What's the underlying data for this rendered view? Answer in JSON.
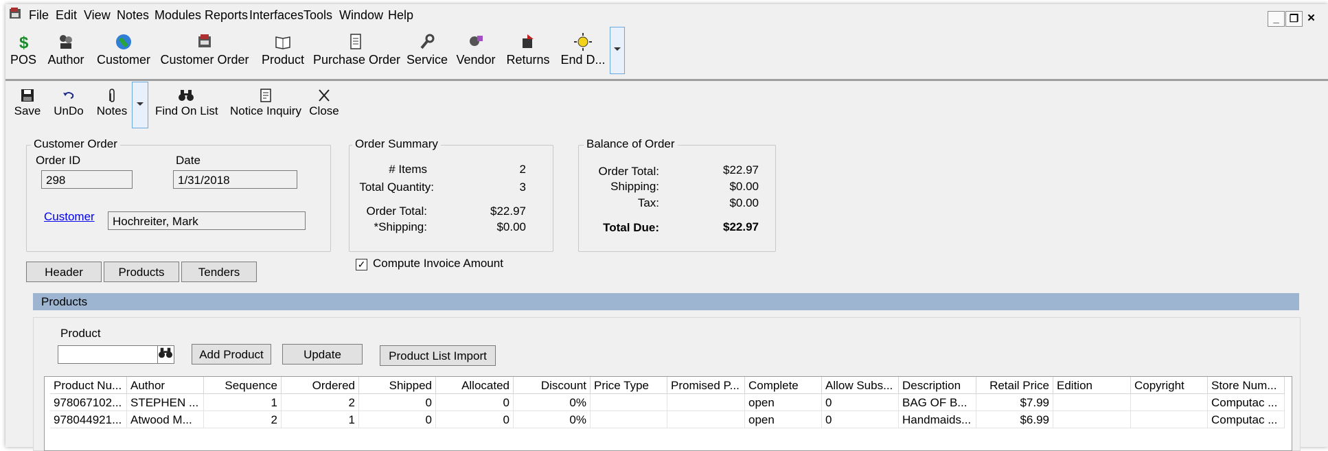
{
  "menu": [
    "File",
    "Edit",
    "View",
    "Notes",
    "Modules",
    "Reports",
    "Interfaces",
    "Tools",
    "Window",
    "Help"
  ],
  "window_controls": {
    "minimize": "_",
    "restore": "❐",
    "close": "✕"
  },
  "modules": [
    {
      "label": "POS",
      "icon": "dollar-icon"
    },
    {
      "label": "Author",
      "icon": "author-icon"
    },
    {
      "label": "Customer",
      "icon": "globe-icon"
    },
    {
      "label": "Customer Order",
      "icon": "register-icon"
    },
    {
      "label": "Product",
      "icon": "book-icon"
    },
    {
      "label": "Purchase Order",
      "icon": "document-icon"
    },
    {
      "label": "Service",
      "icon": "wrench-icon"
    },
    {
      "label": "Vendor",
      "icon": "vendor-icon"
    },
    {
      "label": "Returns",
      "icon": "returns-icon"
    },
    {
      "label": "End D...",
      "icon": "sun-icon"
    }
  ],
  "form_toolbar": {
    "save": "Save",
    "undo": "UnDo",
    "notes": "Notes",
    "find": "Find On List",
    "notice": "Notice Inquiry",
    "close": "Close"
  },
  "customer_order": {
    "title": "Customer Order",
    "order_id_label": "Order ID",
    "order_id": "298",
    "date_label": "Date",
    "date": "1/31/2018",
    "customer_label": "Customer",
    "customer": "Hochreiter, Mark"
  },
  "order_summary": {
    "title": "Order Summary",
    "items_label": "# Items",
    "items": "2",
    "qty_label": "Total Quantity:",
    "qty": "3",
    "total_label": "Order Total:",
    "total": "$22.97",
    "shipping_label": "*Shipping:",
    "shipping": "$0.00"
  },
  "balance": {
    "title": "Balance of Order",
    "total_label": "Order Total:",
    "total": "$22.97",
    "shipping_label": "Shipping:",
    "shipping": "$0.00",
    "tax_label": "Tax:",
    "tax": "$0.00",
    "due_label": "Total Due:",
    "due": "$22.97"
  },
  "compute_invoice": {
    "label": "Compute Invoice Amount",
    "checked": true,
    "mark": "✓"
  },
  "tabs": [
    "Header",
    "Products",
    "Tenders"
  ],
  "products_section": "Products",
  "product_panel": {
    "product_label": "Product",
    "product_value": "",
    "add": "Add Product",
    "update": "Update",
    "import": "Product List Import"
  },
  "grid": {
    "columns": [
      "Product Nu...",
      "Author",
      "Sequence",
      "Ordered",
      "Shipped",
      "Allocated",
      "Discount",
      "Price Type",
      "Promised P...",
      "Complete",
      "Allow Subs...",
      "Description",
      "Retail Price",
      "Edition",
      "Copyright",
      "Store Num..."
    ],
    "rows": [
      [
        "978067102...",
        "STEPHEN ...",
        "1",
        "2",
        "0",
        "0",
        "0%",
        "",
        "",
        "open",
        "0",
        "BAG OF B...",
        "$7.99",
        "",
        "",
        "Computac ..."
      ],
      [
        "978044921...",
        "Atwood M...",
        "2",
        "1",
        "0",
        "0",
        "0%",
        "",
        "",
        "open",
        "0",
        "Handmaids...",
        "$6.99",
        "",
        "",
        "Computac ..."
      ]
    ]
  }
}
